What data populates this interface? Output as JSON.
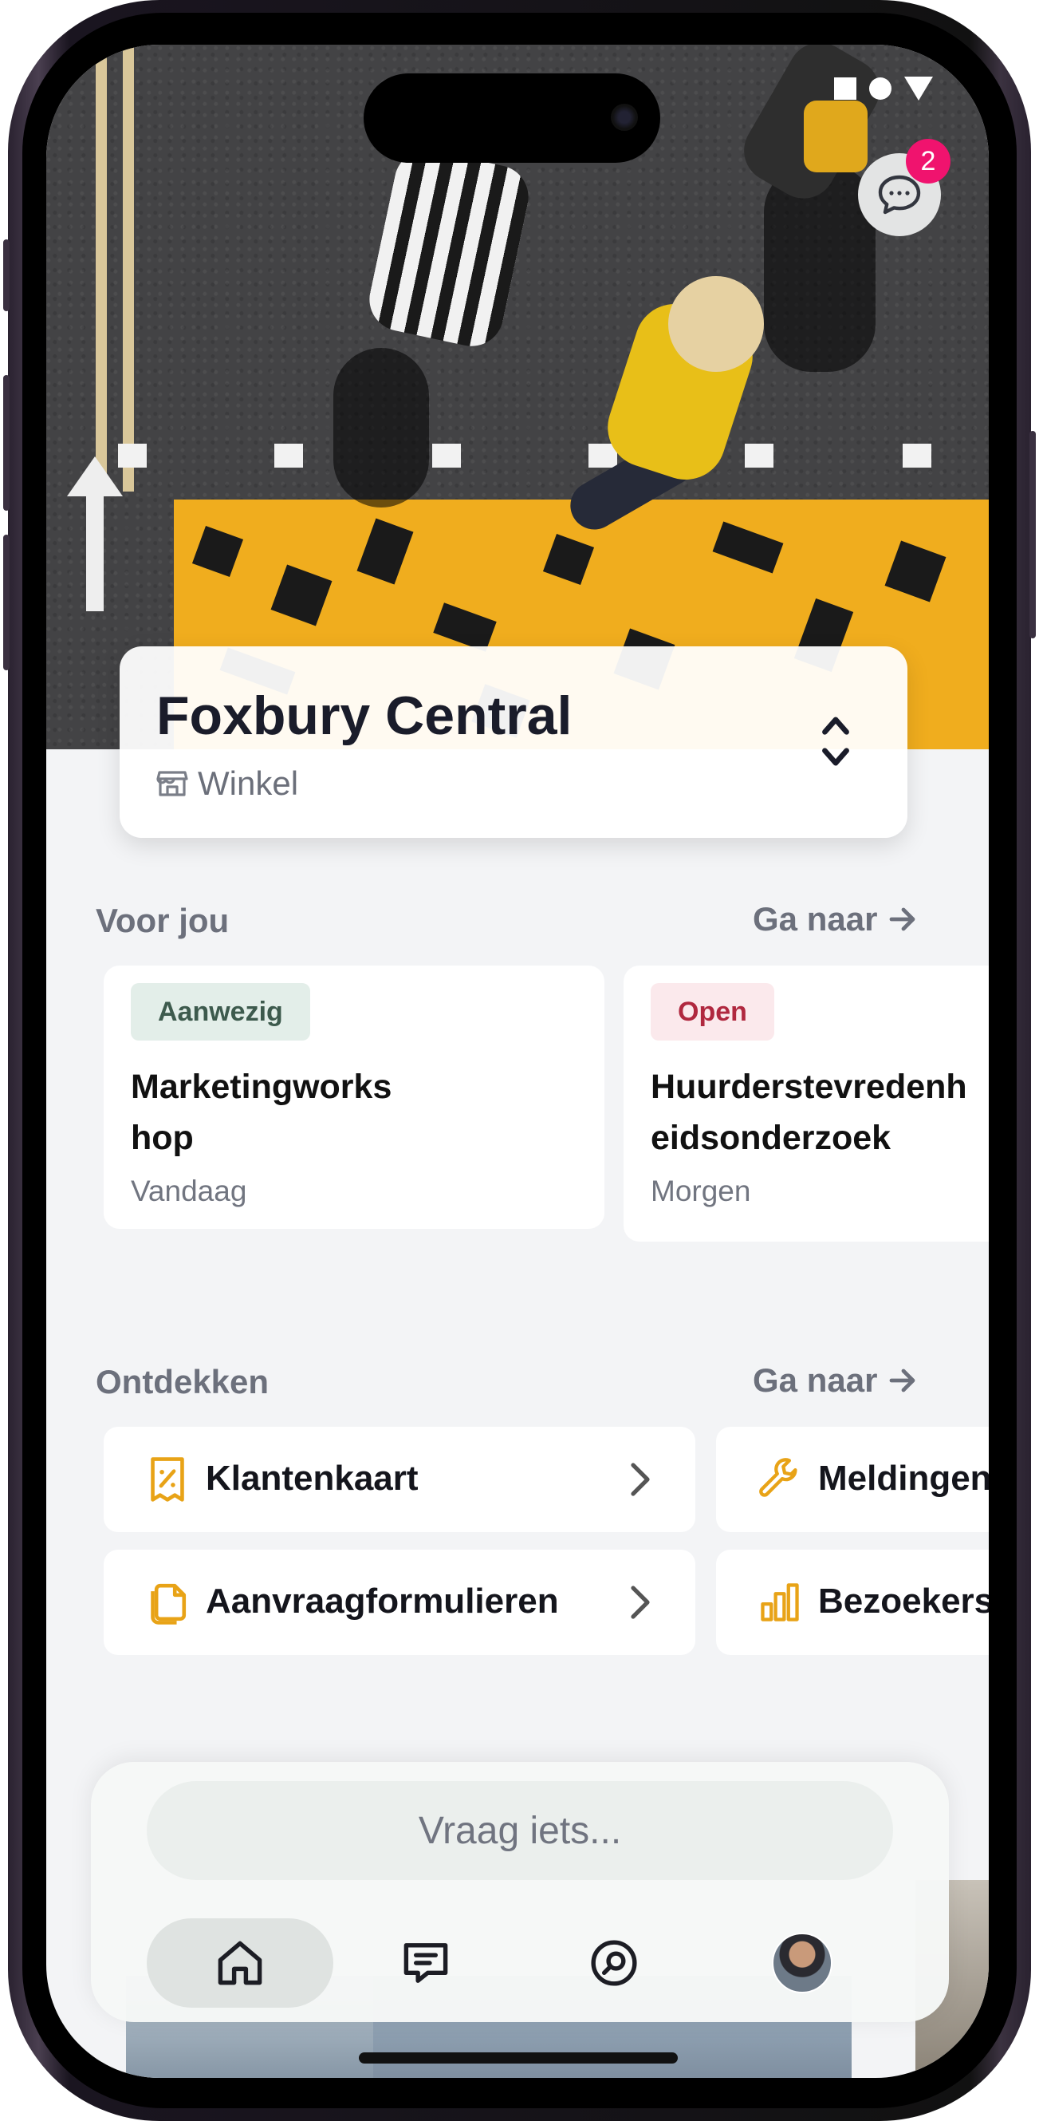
{
  "location": {
    "name": "Foxbury Central",
    "type": "Winkel"
  },
  "chat": {
    "badge_count": "2"
  },
  "for_you": {
    "title": "Voor jou",
    "link": "Ga naar",
    "cards": [
      {
        "status": "Aanwezig",
        "title": "Marketingworks hop",
        "when": "Vandaag",
        "status_color": "#e3eee9",
        "status_text_color": "#3d5a4d"
      },
      {
        "status": "Open",
        "title": "Huurderstevredenh eidsonderzoek",
        "when": "Morgen",
        "status_color": "#fbe9ec",
        "status_text_color": "#b0283f"
      }
    ]
  },
  "discover": {
    "title": "Ontdekken",
    "link": "Ga naar",
    "tiles": [
      {
        "label": "Klantenkaart",
        "icon": "receipt-percent-icon"
      },
      {
        "label": "Meldingen",
        "icon": "wrench-icon"
      },
      {
        "label": "Aanvraagformulieren",
        "icon": "documents-icon"
      },
      {
        "label": "Bezoekers",
        "icon": "bar-chart-icon"
      }
    ]
  },
  "assistant": {
    "placeholder": "Vraag iets..."
  },
  "nav": [
    {
      "name": "home",
      "icon": "home-icon",
      "active": true
    },
    {
      "name": "messages",
      "icon": "message-icon",
      "active": false
    },
    {
      "name": "search",
      "icon": "search-icon",
      "active": false
    },
    {
      "name": "profile",
      "icon": "avatar",
      "active": false
    }
  ],
  "colors": {
    "accent": "#e8a317",
    "notification": "#f0136e",
    "text": "#1a1c2a"
  }
}
